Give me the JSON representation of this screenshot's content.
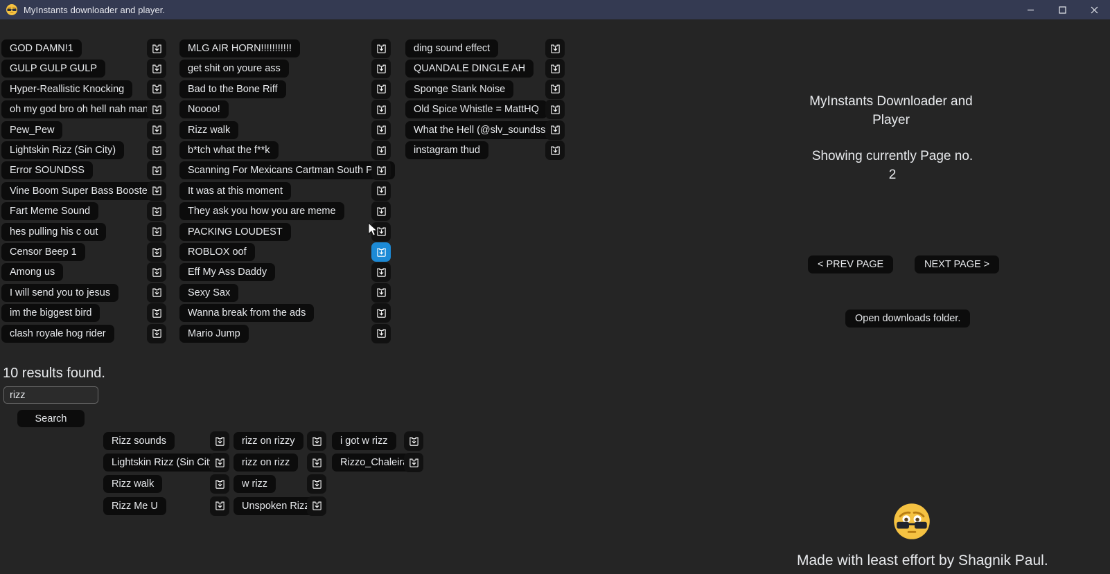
{
  "window": {
    "title": "MyInstants downloader and player.",
    "icon": "sunglasses-face-icon",
    "controls": {
      "minimize": "minimize-icon",
      "maximize": "maximize-icon",
      "close": "close-icon"
    },
    "titlebar_color": "#343a52",
    "background_color": "#252525"
  },
  "theme": {
    "pill_bg": "#0c0c0c",
    "accent_hover": "#1c8ad6",
    "text": "#e8eaed"
  },
  "download_icon_label": "download-tray-icon",
  "sounds": {
    "column1": [
      "GOD DAMN!1",
      "GULP GULP GULP",
      "Hyper-Reallistic Knocking",
      "oh my god bro oh hell nah man",
      "Pew_Pew",
      "Lightskin Rizz (Sin City)",
      "Error SOUNDSS",
      "Vine Boom Super Bass Boosted",
      "Fart Meme Sound",
      "hes pulling his c out",
      "Censor Beep 1",
      "Among us",
      "I will send you to jesus",
      "im the biggest bird",
      "clash royale hog rider"
    ],
    "column2": [
      "MLG AIR HORN!!!!!!!!!!!",
      "get shit on youre ass",
      "Bad to the Bone Riff",
      "Noooo!",
      "Rizz walk",
      "b*tch what the f**k",
      "Scanning For Mexicans Cartman South Park",
      "It was at this moment",
      "They ask you how you are meme",
      "PACKING LOUDEST",
      "ROBLOX oof",
      "Eff My Ass Daddy",
      "Sexy Sax",
      "Wanna break from the ads",
      "Mario Jump"
    ],
    "column3": [
      "ding sound effect",
      "QUANDALE DINGLE AH",
      "Sponge Stank Noise",
      "Old Spice Whistle = MattHQ",
      "What the Hell (@slv_soundss)",
      "instagram thud"
    ],
    "hovered_download_index": {
      "column": 2,
      "row": 10
    }
  },
  "panel": {
    "app_heading": "MyInstants Downloader and Player",
    "page_status": "Showing currently Page no. 2",
    "prev_page_label": "< PREV PAGE",
    "next_page_label": "NEXT PAGE >",
    "open_folder_label": "Open downloads folder."
  },
  "search": {
    "results_label": "10 results found.",
    "input_value": "rizz",
    "input_placeholder": "",
    "button_label": "Search",
    "results_column1": [
      "Rizz sounds",
      "Lightskin Rizz (Sin City)",
      "Rizz walk",
      "Rizz Me U"
    ],
    "results_column2": [
      "rizz on rizzy",
      "rizz on rizz",
      "w rizz",
      "Unspoken Rizz"
    ],
    "results_column3": [
      "i got w rizz",
      "Rizzo_Chaleira"
    ]
  },
  "footer": {
    "emoji": "sunglasses-face-icon",
    "credit": "Made with least effort by Shagnik Paul."
  }
}
